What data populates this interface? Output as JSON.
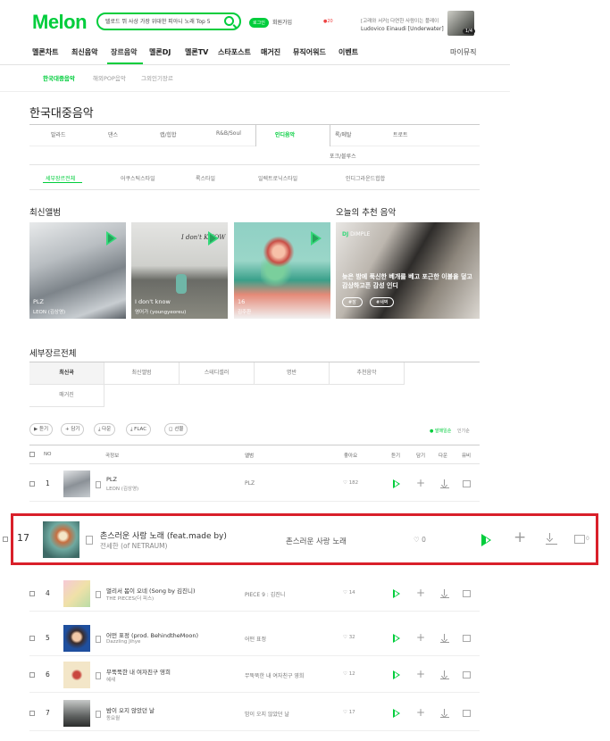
{
  "header": {
    "logo": "Melon",
    "search_value": "텔로드 뛰 사상 가장 위대한 피아니 노래 Top 5",
    "login": "로그인",
    "join": "회원가입",
    "notif": "●20",
    "now_playing": {
      "line1": "[고래와 서커] 다연한 사람이는 플레이",
      "line2": "Ludovico Einaudi [Underwater]",
      "pill": "1/4"
    }
  },
  "gnb": {
    "items": [
      "멜론차트",
      "최신음악",
      "장르음악",
      "멜론DJ",
      "멜론TV",
      "스타포스트",
      "매거진",
      "뮤직어워드",
      "이벤트"
    ],
    "mymusic": "마이뮤직"
  },
  "subnav": [
    "한국대중음악",
    "해외POP음악",
    "그외인기장르"
  ],
  "page_title": "한국대중음악",
  "genre_tabs": {
    "row1": [
      "발라드",
      "댄스",
      "랩/힙합",
      "R&B/Soul",
      "인디음악",
      "록/메탈",
      "트로트"
    ],
    "row2": [
      "포크/블루스"
    ]
  },
  "detail_tabs": [
    "세부장르전체",
    "어쿠스틱스타일",
    "록스타일",
    "일렉트로닉스타일",
    "인디그라운드힙합"
  ],
  "new_albums": {
    "title": "최신앨범",
    "items": [
      {
        "title": "PLZ",
        "artist": "LEON (김상영)"
      },
      {
        "title": "I don't know",
        "artist": "영어가 (youngyeoreu)"
      },
      {
        "title": "16",
        "artist": "김주환"
      }
    ],
    "hand_text": "I don't KNOW"
  },
  "dj": {
    "title": "오늘의 추천 음악",
    "label_prefix": "DJ",
    "label_name": "DIMPLE",
    "text": "늦은 밤에 푹신한 베개를 베고 포근한 이불을 덮고 감상하고픈 감성 인디",
    "tags": [
      "#잠",
      "#새벽"
    ]
  },
  "sub_genre": {
    "title": "세부장르전체",
    "row1": [
      "최신곡",
      "최신앨범",
      "스테디셀러",
      "명반",
      "추천음악"
    ],
    "row2": [
      "매거진"
    ]
  },
  "toolbar": {
    "buttons": [
      "▶ 듣기",
      "+ 담기",
      "⤓ 다운",
      "⤓ FLAC",
      "◻ 선물"
    ],
    "sort_on": "● 발매일순",
    "sort_off": "인기순"
  },
  "table_head": {
    "no": "NO",
    "song": "곡정보",
    "album": "앨범",
    "like": "좋아요",
    "play": "듣기",
    "add": "담기",
    "down": "다운",
    "mv": "뮤비"
  },
  "rows": [
    {
      "rank": "1",
      "title": "PLZ",
      "artist": "LEON (김상영)",
      "album": "PLZ",
      "likes": "182"
    },
    {
      "rank": "4",
      "title": "멀리서 봄이 오네 (Song by 김진니)",
      "artist": "THE PIECES(더 피스)",
      "album": "PIECE 9 : 김진니",
      "likes": "14"
    },
    {
      "rank": "5",
      "title": "어떤 표정 (prod. BehindtheMoon)",
      "artist": "Dazzling Jihye",
      "album": "어떤 표정",
      "likes": "32"
    },
    {
      "rank": "6",
      "title": "무뚝뚝한 내 여자친구 영희",
      "artist": "혜새",
      "album": "무뚝뚝한 내 여자친구 영희",
      "likes": "12"
    },
    {
      "rank": "7",
      "title": "밤이 오지 않았던 날",
      "artist": "동요월",
      "album": "밤이 오지 않았던 날",
      "likes": "17"
    }
  ],
  "highlight": {
    "rank": "17",
    "title": "촌스러운 사랑 노래 (feat.made by)",
    "artist": "전세한 (of NETRAUM)",
    "album": "촌스러운 사랑 노래",
    "likes": "0",
    "mv": "0"
  },
  "colors": {
    "brand": "#00cd3c",
    "highlight_border": "#d9202a"
  }
}
